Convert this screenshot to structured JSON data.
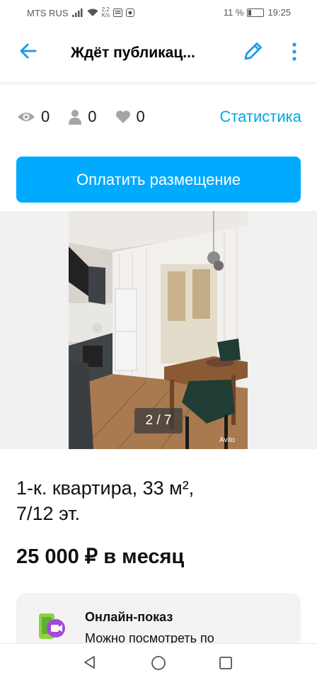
{
  "status_bar": {
    "carrier": "MTS RUS",
    "speed_value": "2,2",
    "speed_unit": "K/s",
    "battery_percent": "11 %",
    "time": "19:25"
  },
  "app_bar": {
    "title": "Ждёт публикац...",
    "icons": [
      "back-arrow-icon",
      "edit-pencil-icon",
      "more-vertical-icon"
    ],
    "accent_color": "#1e9be8"
  },
  "stats": {
    "views": "0",
    "contacts": "0",
    "favorites": "0",
    "link_label": "Статистика",
    "link_color": "#00a8e8"
  },
  "pay_button": {
    "label": "Оплатить размещение",
    "color": "#00aaff"
  },
  "gallery": {
    "counter": "2 / 7",
    "watermark": "Avito"
  },
  "listing": {
    "title_line1": "1-к. квартира, 33 м²,",
    "title_line2": "7/12 эт.",
    "price": "25 000 ₽ в месяц"
  },
  "online_show_card": {
    "title": "Онлайн-показ",
    "text": "Можно посмотреть по"
  },
  "nav_bar": {
    "icons": [
      "back-triangle-icon",
      "home-circle-icon",
      "recents-square-icon"
    ]
  }
}
